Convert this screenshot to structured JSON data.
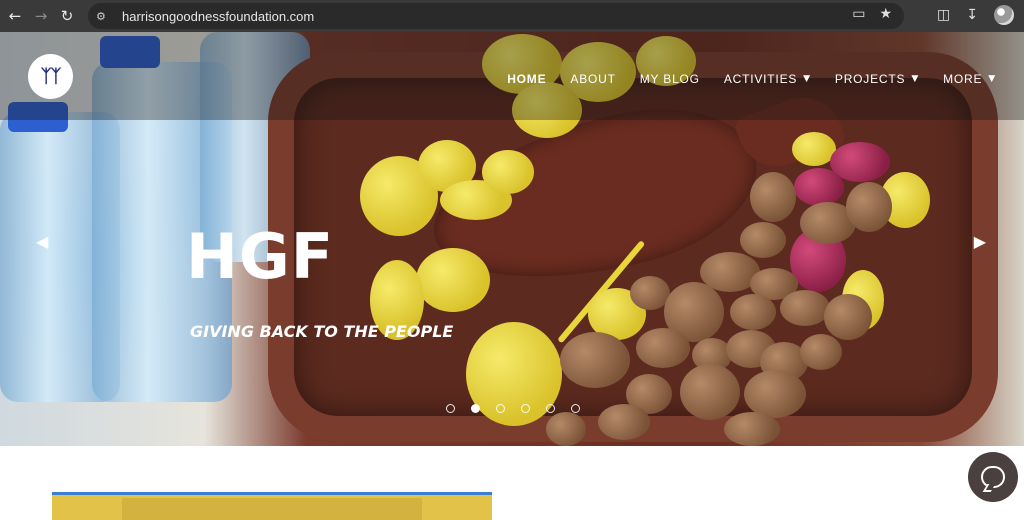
{
  "browser": {
    "url": "harrisongoodnessfoundation.com",
    "icons": [
      "back-icon",
      "forward-icon",
      "reload-icon",
      "site-info-icon",
      "screen-cast-icon",
      "bookmark-star-icon",
      "extensions-icon",
      "download-icon",
      "profile-icon"
    ]
  },
  "nav": {
    "items": [
      {
        "label": "HOME",
        "active": true,
        "dropdown": false
      },
      {
        "label": "ABOUT",
        "active": false,
        "dropdown": false
      },
      {
        "label": "MY BLOG",
        "active": false,
        "dropdown": false
      },
      {
        "label": "ACTIVITIES",
        "active": false,
        "dropdown": true
      },
      {
        "label": "PROJECTS",
        "active": false,
        "dropdown": true
      },
      {
        "label": "MORE",
        "active": false,
        "dropdown": true
      }
    ]
  },
  "hero": {
    "title": "HGF",
    "subtitle": "GIVING BACK TO THE PEOPLE",
    "slides_total": 6,
    "active_slide": 2
  },
  "colors": {
    "chrome_bg": "#3a3a3a",
    "chat_button": "#4a4040",
    "logo_mark": "#26307a"
  }
}
